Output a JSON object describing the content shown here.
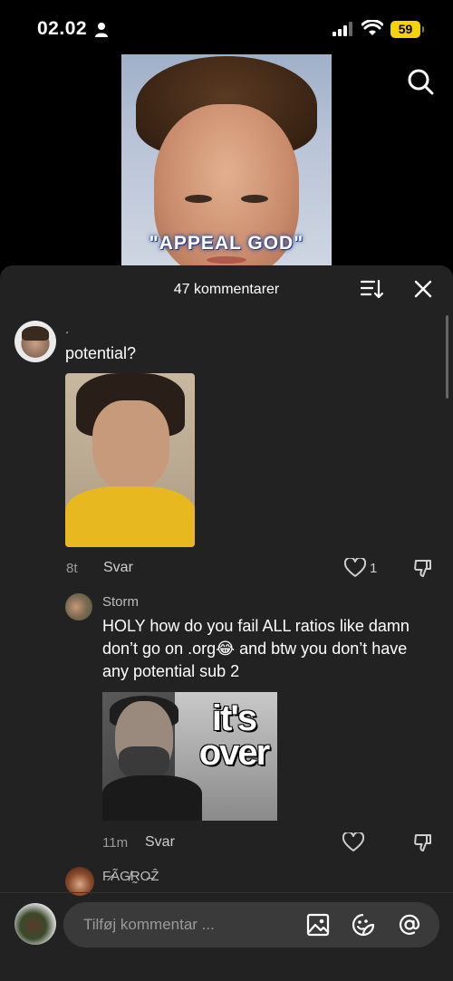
{
  "status_bar": {
    "time": "02.02",
    "battery": "59"
  },
  "video": {
    "caption": "\"APPEAL GOD\""
  },
  "comments_sheet": {
    "title": "47 kommentarer",
    "comments": [
      {
        "author": ".",
        "text": "potential?",
        "age": "8t",
        "reply_label": "Svar",
        "likes": "1",
        "has_image": true
      },
      {
        "author": "Storm",
        "text": "HOLY how do you fail ALL ratios like damn don’t go on .org😂 and btw you don’t have any potential sub 2",
        "age": "11m",
        "reply_label": "Svar",
        "image_text": "it's over",
        "has_image": true
      },
      {
        "author": "F̷ÃG̸R̰O̶Ẑ"
      }
    ]
  },
  "input": {
    "placeholder": "Tilføj kommentar ..."
  },
  "colors": {
    "sheet_bg": "#222222",
    "battery": "#f5d20a",
    "input_bg": "#3a3a3a"
  },
  "icons": [
    "person-icon",
    "signal-icon",
    "wifi-icon",
    "search-icon",
    "sort-icon",
    "close-icon",
    "heart-icon",
    "dislike-icon",
    "image-icon",
    "sticker-icon",
    "mention-icon"
  ]
}
